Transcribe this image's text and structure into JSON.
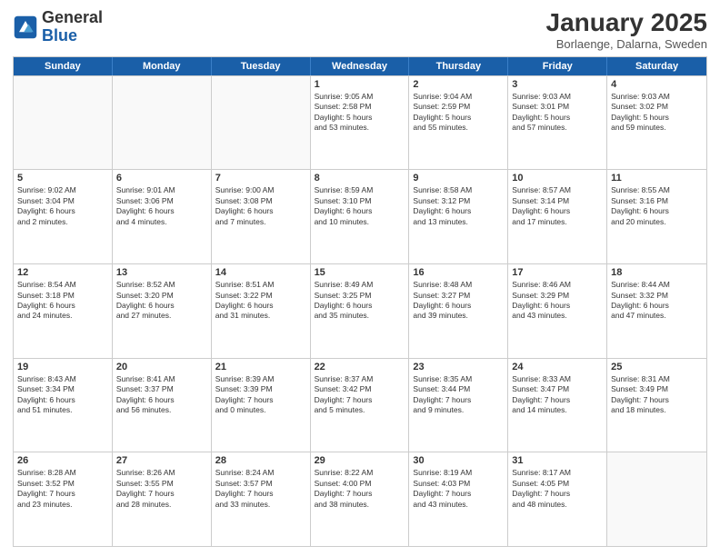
{
  "header": {
    "logo_line1": "General",
    "logo_line2": "Blue",
    "month": "January 2025",
    "location": "Borlaenge, Dalarna, Sweden"
  },
  "weekdays": [
    "Sunday",
    "Monday",
    "Tuesday",
    "Wednesday",
    "Thursday",
    "Friday",
    "Saturday"
  ],
  "rows": [
    [
      {
        "day": "",
        "info": ""
      },
      {
        "day": "",
        "info": ""
      },
      {
        "day": "",
        "info": ""
      },
      {
        "day": "1",
        "info": "Sunrise: 9:05 AM\nSunset: 2:58 PM\nDaylight: 5 hours\nand 53 minutes."
      },
      {
        "day": "2",
        "info": "Sunrise: 9:04 AM\nSunset: 2:59 PM\nDaylight: 5 hours\nand 55 minutes."
      },
      {
        "day": "3",
        "info": "Sunrise: 9:03 AM\nSunset: 3:01 PM\nDaylight: 5 hours\nand 57 minutes."
      },
      {
        "day": "4",
        "info": "Sunrise: 9:03 AM\nSunset: 3:02 PM\nDaylight: 5 hours\nand 59 minutes."
      }
    ],
    [
      {
        "day": "5",
        "info": "Sunrise: 9:02 AM\nSunset: 3:04 PM\nDaylight: 6 hours\nand 2 minutes."
      },
      {
        "day": "6",
        "info": "Sunrise: 9:01 AM\nSunset: 3:06 PM\nDaylight: 6 hours\nand 4 minutes."
      },
      {
        "day": "7",
        "info": "Sunrise: 9:00 AM\nSunset: 3:08 PM\nDaylight: 6 hours\nand 7 minutes."
      },
      {
        "day": "8",
        "info": "Sunrise: 8:59 AM\nSunset: 3:10 PM\nDaylight: 6 hours\nand 10 minutes."
      },
      {
        "day": "9",
        "info": "Sunrise: 8:58 AM\nSunset: 3:12 PM\nDaylight: 6 hours\nand 13 minutes."
      },
      {
        "day": "10",
        "info": "Sunrise: 8:57 AM\nSunset: 3:14 PM\nDaylight: 6 hours\nand 17 minutes."
      },
      {
        "day": "11",
        "info": "Sunrise: 8:55 AM\nSunset: 3:16 PM\nDaylight: 6 hours\nand 20 minutes."
      }
    ],
    [
      {
        "day": "12",
        "info": "Sunrise: 8:54 AM\nSunset: 3:18 PM\nDaylight: 6 hours\nand 24 minutes."
      },
      {
        "day": "13",
        "info": "Sunrise: 8:52 AM\nSunset: 3:20 PM\nDaylight: 6 hours\nand 27 minutes."
      },
      {
        "day": "14",
        "info": "Sunrise: 8:51 AM\nSunset: 3:22 PM\nDaylight: 6 hours\nand 31 minutes."
      },
      {
        "day": "15",
        "info": "Sunrise: 8:49 AM\nSunset: 3:25 PM\nDaylight: 6 hours\nand 35 minutes."
      },
      {
        "day": "16",
        "info": "Sunrise: 8:48 AM\nSunset: 3:27 PM\nDaylight: 6 hours\nand 39 minutes."
      },
      {
        "day": "17",
        "info": "Sunrise: 8:46 AM\nSunset: 3:29 PM\nDaylight: 6 hours\nand 43 minutes."
      },
      {
        "day": "18",
        "info": "Sunrise: 8:44 AM\nSunset: 3:32 PM\nDaylight: 6 hours\nand 47 minutes."
      }
    ],
    [
      {
        "day": "19",
        "info": "Sunrise: 8:43 AM\nSunset: 3:34 PM\nDaylight: 6 hours\nand 51 minutes."
      },
      {
        "day": "20",
        "info": "Sunrise: 8:41 AM\nSunset: 3:37 PM\nDaylight: 6 hours\nand 56 minutes."
      },
      {
        "day": "21",
        "info": "Sunrise: 8:39 AM\nSunset: 3:39 PM\nDaylight: 7 hours\nand 0 minutes."
      },
      {
        "day": "22",
        "info": "Sunrise: 8:37 AM\nSunset: 3:42 PM\nDaylight: 7 hours\nand 5 minutes."
      },
      {
        "day": "23",
        "info": "Sunrise: 8:35 AM\nSunset: 3:44 PM\nDaylight: 7 hours\nand 9 minutes."
      },
      {
        "day": "24",
        "info": "Sunrise: 8:33 AM\nSunset: 3:47 PM\nDaylight: 7 hours\nand 14 minutes."
      },
      {
        "day": "25",
        "info": "Sunrise: 8:31 AM\nSunset: 3:49 PM\nDaylight: 7 hours\nand 18 minutes."
      }
    ],
    [
      {
        "day": "26",
        "info": "Sunrise: 8:28 AM\nSunset: 3:52 PM\nDaylight: 7 hours\nand 23 minutes."
      },
      {
        "day": "27",
        "info": "Sunrise: 8:26 AM\nSunset: 3:55 PM\nDaylight: 7 hours\nand 28 minutes."
      },
      {
        "day": "28",
        "info": "Sunrise: 8:24 AM\nSunset: 3:57 PM\nDaylight: 7 hours\nand 33 minutes."
      },
      {
        "day": "29",
        "info": "Sunrise: 8:22 AM\nSunset: 4:00 PM\nDaylight: 7 hours\nand 38 minutes."
      },
      {
        "day": "30",
        "info": "Sunrise: 8:19 AM\nSunset: 4:03 PM\nDaylight: 7 hours\nand 43 minutes."
      },
      {
        "day": "31",
        "info": "Sunrise: 8:17 AM\nSunset: 4:05 PM\nDaylight: 7 hours\nand 48 minutes."
      },
      {
        "day": "",
        "info": ""
      }
    ]
  ]
}
